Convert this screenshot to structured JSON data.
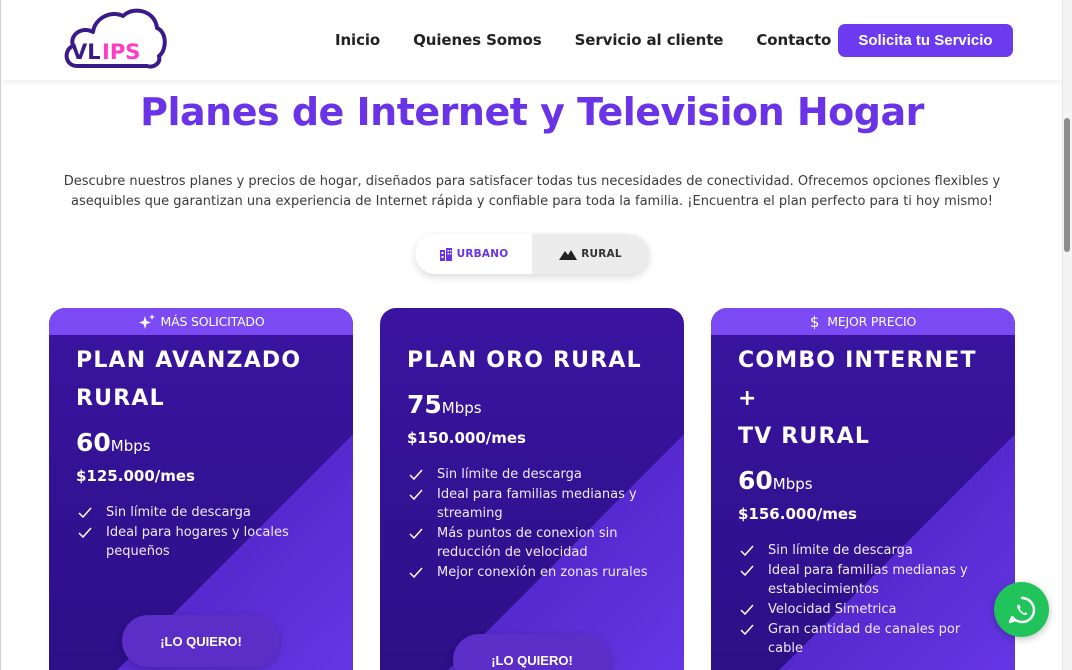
{
  "logo": {
    "text": "VLIPS",
    "colors": {
      "cloud": "#3a1a8a",
      "accent": "#ff3cc7"
    }
  },
  "nav": {
    "items": [
      "Inicio",
      "Quienes Somos",
      "Servicio al cliente",
      "Contacto"
    ],
    "cta_label": "Solicita tu Servicio"
  },
  "hero": {
    "title": "Planes de Internet y Television Hogar",
    "description_line1": "Descubre nuestros planes y precios de hogar, diseñados para satisfacer todas tus necesidades de conectividad. Ofrecemos opciones flexibles y",
    "description_line2": "asequibles que garantizan una experiencia de Internet rápida y confiable para toda la familia. ¡Encuentra el plan perfecto para ti hoy mismo!"
  },
  "toggle": {
    "options": [
      {
        "label": "URBANO",
        "icon": "building-icon",
        "active": true
      },
      {
        "label": "RURAL",
        "icon": "mountain-icon",
        "active": false
      }
    ]
  },
  "plans": [
    {
      "badge": "MÁS SOLICITADO",
      "badge_icon": "sparkle-icon",
      "title_line1": "PLAN AVANZADO",
      "title_line2": "RURAL",
      "speed": "60",
      "unit": "Mbps",
      "price": "$125.000/mes",
      "features": [
        "Sin límite de descarga",
        "Ideal para hogares y locales pequeños"
      ],
      "button": "¡LO QUIERO!"
    },
    {
      "badge": "",
      "title_line1": "PLAN ORO RURAL",
      "title_line2": "",
      "speed": "75",
      "unit": "Mbps",
      "price": "$150.000/mes",
      "features": [
        "Sin límite de descarga",
        "Ideal para familias medianas y streaming",
        "Más puntos de conexion sin reducción de velocidad",
        "Mejor conexión en zonas rurales"
      ],
      "button": "¡LO QUIERO!"
    },
    {
      "badge": "MEJOR PRECIO",
      "badge_icon": "dollar-icon",
      "title_line1": "COMBO INTERNET +",
      "title_line2": "TV RURAL",
      "speed": "60",
      "unit": "Mbps",
      "price": "$156.000/mes",
      "features": [
        "Sin límite de descarga",
        "Ideal para familias medianas y establecimientos",
        "Velocidad Simetrica",
        "Gran cantidad de canales por cable"
      ],
      "button": "¡LO QUIERO!"
    }
  ],
  "colors": {
    "brand": "#6c3bf0",
    "title": "#6a33e8",
    "card": "#3a14a0",
    "whatsapp": "#21c45b"
  }
}
